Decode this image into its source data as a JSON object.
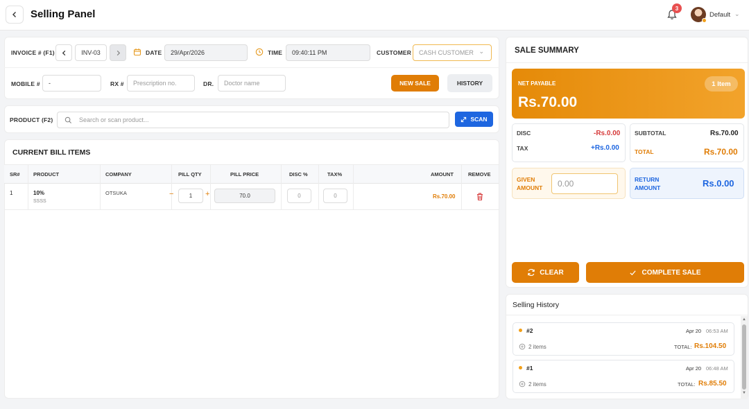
{
  "header": {
    "title": "Selling Panel",
    "notification_count": "3",
    "user_name": "Default"
  },
  "invoice": {
    "invoice_label": "INVOICE # (F1)",
    "invoice_value": "INV-03",
    "date_label": "DATE",
    "date_value": "29/Apr/2026",
    "time_label": "TIME",
    "time_value": "09:40:11 PM",
    "customer_label": "CUSTOMER",
    "customer_value": "CASH CUSTOMER",
    "mobile_label": "MOBILE #",
    "mobile_value": "-",
    "rx_label": "RX #",
    "rx_placeholder": "Prescription no.",
    "dr_label": "DR.",
    "dr_placeholder": "Doctor name",
    "new_sale_label": "NEW SALE",
    "history_label": "HISTORY"
  },
  "product_search": {
    "label": "PRODUCT (F2)",
    "placeholder": "Search or scan product...",
    "scan_label": "SCAN"
  },
  "bill": {
    "title": "CURRENT BILL ITEMS",
    "columns": [
      "SR#",
      "PRODUCT",
      "COMPANY",
      "PILL QTY",
      "PILL PRICE",
      "DISC %",
      "TAX%",
      "AMOUNT",
      "REMOVE"
    ],
    "rows": [
      {
        "sr": "1",
        "product": "10%",
        "product_sub": "SSSS",
        "company": "OTSUKA",
        "qty": "1",
        "price": "70.0",
        "disc": "0",
        "tax": "0",
        "amount": "Rs.70.00"
      }
    ]
  },
  "summary": {
    "title": "SALE SUMMARY",
    "net_payable_label": "NET PAYABLE",
    "net_payable_value": "Rs.70.00",
    "items_badge": "1 Item",
    "disc_label": "DISC",
    "disc_value": "-Rs.0.00",
    "tax_label": "TAX",
    "tax_value": "+Rs.0.00",
    "subtotal_label": "SUBTOTAL",
    "subtotal_value": "Rs.70.00",
    "total_label": "TOTAL",
    "total_value": "Rs.70.00",
    "given_label_1": "GIVEN",
    "given_label_2": "AMOUNT",
    "given_value": "0.00",
    "return_label_1": "RETURN",
    "return_label_2": "AMOUNT",
    "return_value": "Rs.0.00",
    "clear_label": "CLEAR",
    "complete_label": "COMPLETE SALE"
  },
  "history": {
    "title": "Selling History",
    "items": [
      {
        "id": "#2",
        "date": "Apr 20",
        "time": "06:53 AM",
        "count": "2 items",
        "total_label": "TOTAL:",
        "total": "Rs.104.50"
      },
      {
        "id": "#1",
        "date": "Apr 20",
        "time": "06:48 AM",
        "count": "2 items",
        "total_label": "TOTAL:",
        "total": "Rs.85.50"
      }
    ]
  },
  "colors": {
    "accent": "#e07d06",
    "blue": "#1e66e0",
    "red": "#d63a3a"
  }
}
